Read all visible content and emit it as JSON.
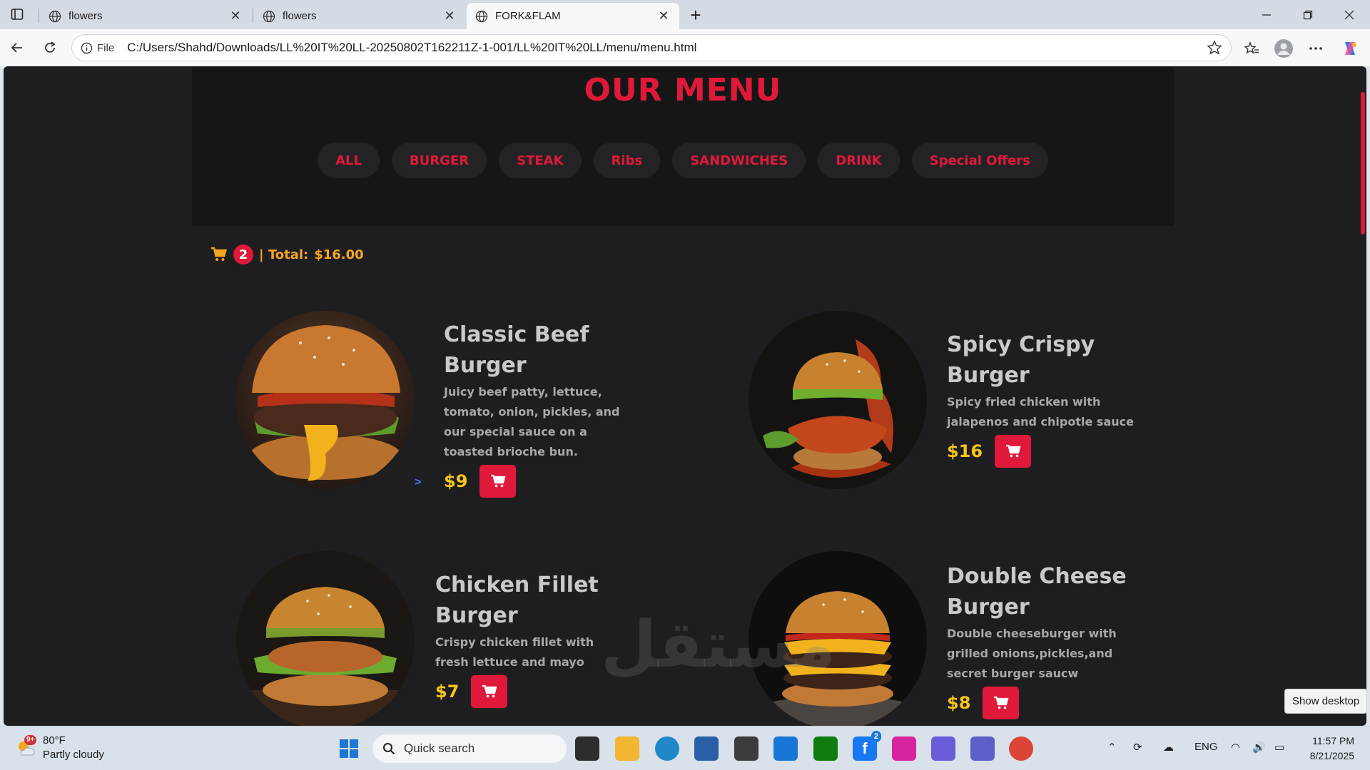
{
  "browser": {
    "tabs": [
      {
        "title": "flowers",
        "active": false
      },
      {
        "title": "flowers",
        "active": false
      },
      {
        "title": "FORK&FLAM",
        "active": true
      }
    ],
    "url_scheme_label": "File",
    "url": "C:/Users/Shahd/Downloads/LL%20IT%20LL-20250802T162211Z-1-001/LL%20IT%20LL/menu/menu.html"
  },
  "page": {
    "title": "OUR MENU",
    "categories": [
      "ALL",
      "BURGER",
      "STEAK",
      "Ribs",
      "SANDWICHES",
      "DRINK",
      "Special Offers"
    ],
    "cart": {
      "count": "2",
      "total_label": "| Total:",
      "total": "$16.00"
    },
    "items": [
      {
        "name_line1": "Classic Beef",
        "name_line2": "Burger",
        "desc": "Juicy beef patty, lettuce, tomato, onion, pickles, and our special sauce on a toasted brioche bun.",
        "price": "$9"
      },
      {
        "name_line1": "Spicy Crispy",
        "name_line2": "Burger",
        "desc": "Spicy fried chicken with jalapenos and chipotle sauce",
        "price": "$16"
      },
      {
        "name_line1": "Chicken Fillet",
        "name_line2": "Burger",
        "desc": "Crispy chicken fillet with fresh lettuce and mayo",
        "price": "$7"
      },
      {
        "name_line1": "Double Cheese",
        "name_line2": "Burger",
        "desc": "Double cheeseburger with grilled onions,pickles,and secret burger saucw",
        "price": "$8"
      }
    ],
    "arrow_text": ">",
    "watermark": "مستقل"
  },
  "taskbar": {
    "weather_temp": "80°F",
    "weather_desc": "Partly cloudy",
    "weather_badge": "9+",
    "search_placeholder": "Quick search",
    "facebook_badge": "2",
    "language": "ENG",
    "time": "11:57 PM",
    "date": "8/21/2025",
    "show_desktop": "Show desktop"
  },
  "colors": {
    "accent": "#e0193a",
    "price": "#f5c518",
    "cart_text": "#f5a623",
    "page_bg": "#1e1e20"
  }
}
